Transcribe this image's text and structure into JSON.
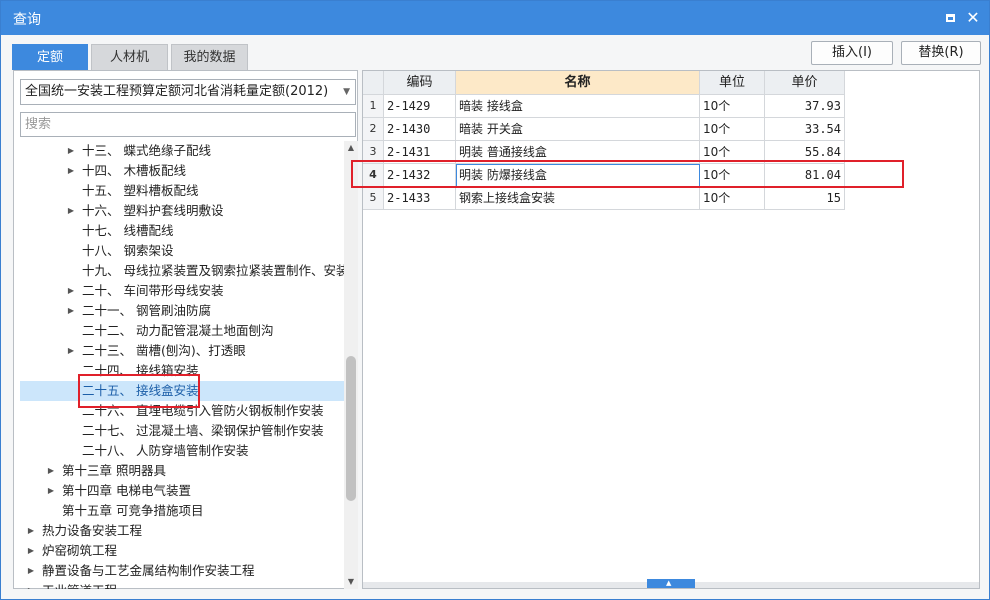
{
  "window": {
    "title": "查询"
  },
  "tabs": [
    {
      "label": "定额",
      "active": true
    },
    {
      "label": "人材机",
      "active": false
    },
    {
      "label": "我的数据",
      "active": false
    }
  ],
  "toolbar": {
    "insert_label": "插入(I)",
    "replace_label": "替换(R)"
  },
  "quota_select": {
    "value": "全国统一安装工程预算定额河北省消耗量定额(2012)"
  },
  "search": {
    "placeholder": "搜索"
  },
  "tree": {
    "items": [
      {
        "label": "十三、 蝶式绝缘子配线",
        "level": 2,
        "expandable": true
      },
      {
        "label": "十四、 木槽板配线",
        "level": 2,
        "expandable": true
      },
      {
        "label": "十五、 塑料槽板配线",
        "level": 2,
        "expandable": false
      },
      {
        "label": "十六、 塑料护套线明敷设",
        "level": 2,
        "expandable": true
      },
      {
        "label": "十七、 线槽配线",
        "level": 2,
        "expandable": false
      },
      {
        "label": "十八、 钢索架设",
        "level": 2,
        "expandable": false
      },
      {
        "label": "十九、 母线拉紧装置及钢索拉紧装置制作、安装",
        "level": 2,
        "expandable": false
      },
      {
        "label": "二十、 车间带形母线安装",
        "level": 2,
        "expandable": true
      },
      {
        "label": "二十一、 钢管刷油防腐",
        "level": 2,
        "expandable": true
      },
      {
        "label": "二十二、 动力配管混凝土地面刨沟",
        "level": 2,
        "expandable": false
      },
      {
        "label": "二十三、 凿槽(刨沟)、打透眼",
        "level": 2,
        "expandable": true
      },
      {
        "label": "二十四、 接线箱安装",
        "level": 2,
        "expandable": false
      },
      {
        "label": "二十五、 接线盒安装",
        "level": 2,
        "expandable": false,
        "selected": true
      },
      {
        "label": "二十六、 直埋电缆引入管防火钢板制作安装",
        "level": 2,
        "expandable": false
      },
      {
        "label": "二十七、 过混凝土墙、梁钢保护管制作安装",
        "level": 2,
        "expandable": false
      },
      {
        "label": "二十八、 人防穿墙管制作安装",
        "level": 2,
        "expandable": false
      },
      {
        "label": "第十三章 照明器具",
        "level": 1,
        "expandable": true
      },
      {
        "label": "第十四章 电梯电气装置",
        "level": 1,
        "expandable": true
      },
      {
        "label": "第十五章 可竞争措施项目",
        "level": 1,
        "expandable": false
      },
      {
        "label": "热力设备安装工程",
        "level": 0,
        "expandable": true
      },
      {
        "label": "炉窑砌筑工程",
        "level": 0,
        "expandable": true
      },
      {
        "label": "静置设备与工艺金属结构制作安装工程",
        "level": 0,
        "expandable": true
      },
      {
        "label": "工业管道工程",
        "level": 0,
        "expandable": true
      }
    ]
  },
  "table": {
    "columns": [
      "编码",
      "名称",
      "单位",
      "单价"
    ],
    "sorted_column": 1,
    "rows": [
      {
        "no": "1",
        "code": "2-1429",
        "name": "暗装 接线盒",
        "unit": "10个",
        "price": "37.93"
      },
      {
        "no": "2",
        "code": "2-1430",
        "name": "暗装 开关盒",
        "unit": "10个",
        "price": "33.54"
      },
      {
        "no": "3",
        "code": "2-1431",
        "name": "明装 普通接线盒",
        "unit": "10个",
        "price": "55.84"
      },
      {
        "no": "4",
        "code": "2-1432",
        "name": "明装 防爆接线盒",
        "unit": "10个",
        "price": "81.04",
        "current": true
      },
      {
        "no": "5",
        "code": "2-1433",
        "name": "钢索上接线盒安装",
        "unit": "10个",
        "price": "15"
      }
    ]
  },
  "icons": {
    "tree_expand": "triangle-right-icon",
    "scroll_up": "chevron-up-icon",
    "scroll_down": "chevron-down-icon"
  },
  "colors": {
    "accent": "#3d89de",
    "highlight": "#e0202a",
    "selection": "#cce6fb",
    "header_active": "#fde9c8"
  }
}
